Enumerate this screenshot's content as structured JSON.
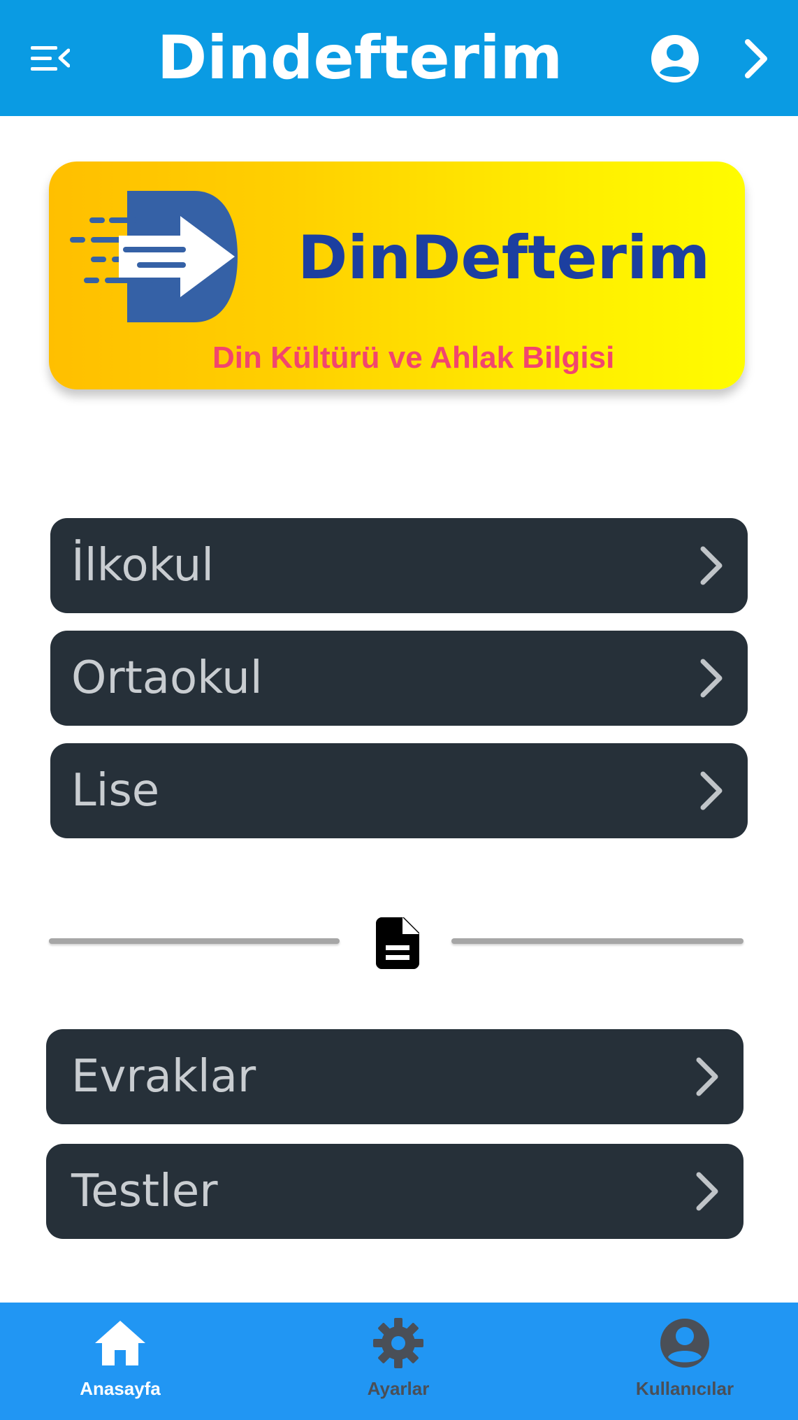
{
  "appbar": {
    "title": "Dindefterim",
    "menu_icon": "menu-open-icon",
    "account_icon": "account-circle-icon",
    "forward_icon": "chevron-right-icon",
    "color": "#0a9be3"
  },
  "banner": {
    "brand": "DinDefterim",
    "subtitle": "Din Kültürü ve Ahlak Bilgisi",
    "brand_color": "#1c3fa0",
    "subtitle_color": "#f2456e"
  },
  "levels": [
    {
      "label": "İlkokul"
    },
    {
      "label": "Ortaokul"
    },
    {
      "label": "Lise"
    }
  ],
  "divider_icon": "document-icon",
  "resources": [
    {
      "label": "Evraklar"
    },
    {
      "label": "Testler"
    }
  ],
  "bottom_nav": {
    "items": [
      {
        "label": "Anasayfa",
        "icon": "home-icon",
        "active": true
      },
      {
        "label": "Ayarlar",
        "icon": "gear-icon",
        "active": false
      },
      {
        "label": "Kullanıcılar",
        "icon": "account-circle-icon",
        "active": false
      }
    ],
    "color": "#2196f3"
  }
}
